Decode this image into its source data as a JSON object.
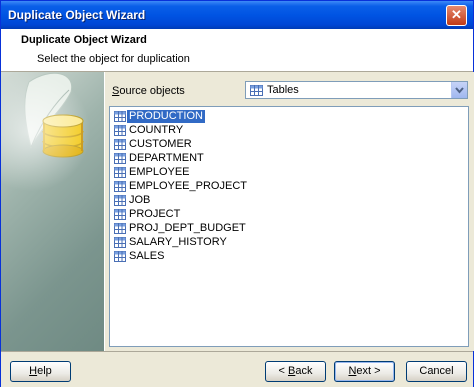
{
  "window": {
    "title": "Duplicate Object Wizard",
    "close_glyph": "✕"
  },
  "header": {
    "title": "Duplicate Object Wizard",
    "subtitle": "Select the object for duplication"
  },
  "source": {
    "label_prefix": "S",
    "label_rest": "ource objects",
    "selected": "Tables",
    "icon": "table-icon"
  },
  "objects": {
    "selected_index": 0,
    "items": [
      "PRODUCTION",
      "COUNTRY",
      "CUSTOMER",
      "DEPARTMENT",
      "EMPLOYEE",
      "EMPLOYEE_PROJECT",
      "JOB",
      "PROJECT",
      "PROJ_DEPT_BUDGET",
      "SALARY_HISTORY",
      "SALES"
    ]
  },
  "buttons": {
    "help": {
      "mn": "H",
      "rest": "elp"
    },
    "back": {
      "pre": "< ",
      "mn": "B",
      "rest": "ack"
    },
    "next": {
      "mn": "N",
      "rest": "ext >"
    },
    "cancel": {
      "label": "Cancel"
    }
  },
  "colors": {
    "titlebar": "#0054e3",
    "selection": "#316ac5",
    "face": "#ece9d8"
  }
}
